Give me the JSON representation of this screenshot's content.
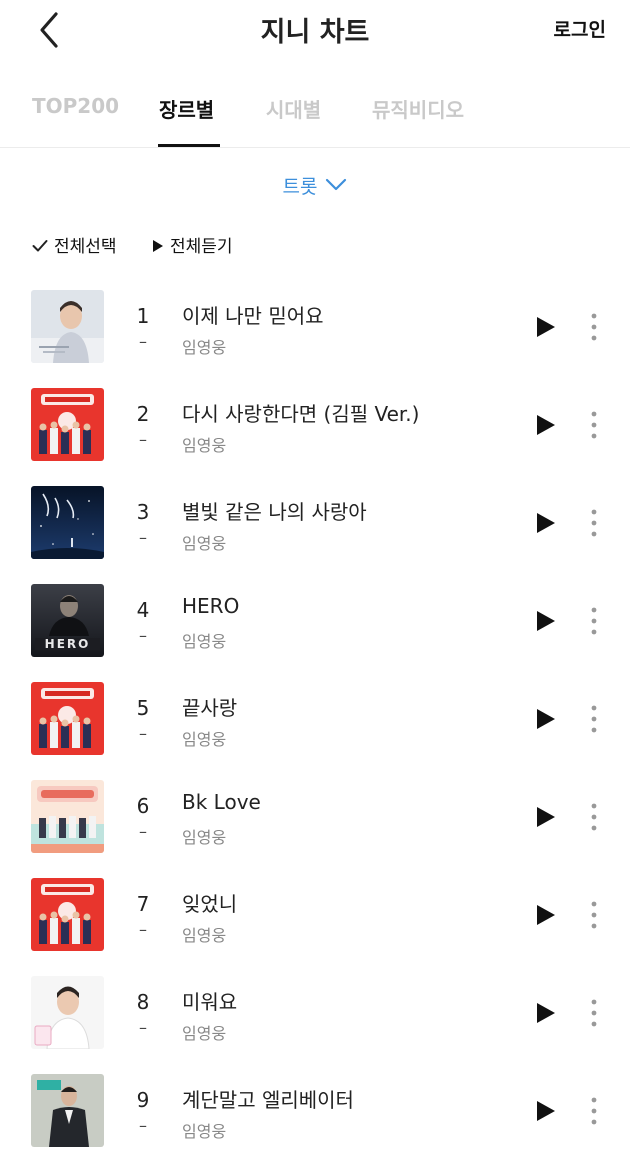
{
  "header": {
    "title": "지니 차트",
    "login_label": "로그인"
  },
  "tabs": [
    {
      "label": "TOP200",
      "active": false
    },
    {
      "label": "장르별",
      "active": true
    },
    {
      "label": "시대별",
      "active": false
    },
    {
      "label": "뮤직비디오",
      "active": false
    }
  ],
  "genre": {
    "label": "트롯"
  },
  "actions": {
    "select_all": "전체선택",
    "play_all": "전체듣기"
  },
  "tracks": [
    {
      "rank": "1",
      "change": "–",
      "title": "이제 나만 믿어요",
      "artist": "임영웅",
      "cover": "portrait-light"
    },
    {
      "rank": "2",
      "change": "–",
      "title": "다시 사랑한다면 (김필 Ver.)",
      "artist": "임영웅",
      "cover": "red-group"
    },
    {
      "rank": "3",
      "change": "–",
      "title": "별빛 같은 나의 사랑아",
      "artist": "임영웅",
      "cover": "night-sky"
    },
    {
      "rank": "4",
      "change": "–",
      "title": "HERO",
      "artist": "임영웅",
      "cover": "hero"
    },
    {
      "rank": "5",
      "change": "–",
      "title": "끝사랑",
      "artist": "임영웅",
      "cover": "red-group"
    },
    {
      "rank": "6",
      "change": "–",
      "title": "Bk Love",
      "artist": "임영웅",
      "cover": "pastel-group"
    },
    {
      "rank": "7",
      "change": "–",
      "title": "잊었니",
      "artist": "임영웅",
      "cover": "red-group"
    },
    {
      "rank": "8",
      "change": "–",
      "title": "미워요",
      "artist": "임영웅",
      "cover": "portrait-white"
    },
    {
      "rank": "9",
      "change": "–",
      "title": "계단말고 엘리베이터",
      "artist": "임영웅",
      "cover": "suit-dark"
    }
  ],
  "colors": {
    "accent": "#3d8fdb",
    "inactive_tab": "#c9c9c9",
    "artist_text": "#888888"
  }
}
